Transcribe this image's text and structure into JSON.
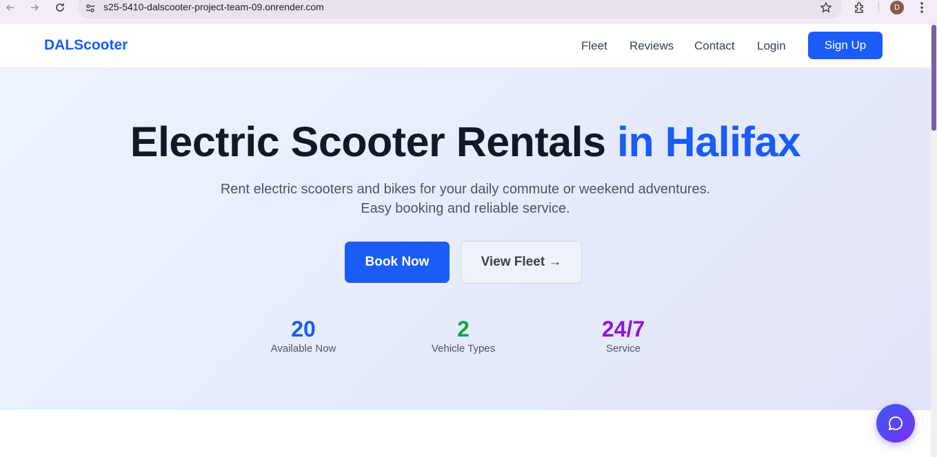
{
  "browser": {
    "url": "s25-5410-dalscooter-project-team-09.onrender.com",
    "profile_initial": "D"
  },
  "header": {
    "brand": "DALScooter",
    "nav": [
      "Fleet",
      "Reviews",
      "Contact",
      "Login"
    ],
    "signup_label": "Sign Up"
  },
  "hero": {
    "title_main": "Electric Scooter Rentals ",
    "title_accent": "in Halifax",
    "subtitle_line1": "Rent electric scooters and bikes for your daily commute or weekend adventures.",
    "subtitle_line2": "Easy booking and reliable service.",
    "primary_cta": "Book Now",
    "secondary_cta": "View Fleet →",
    "stats": [
      {
        "value": "20",
        "label": "Available Now",
        "color": "#1a5cf5"
      },
      {
        "value": "2",
        "label": "Vehicle Types",
        "color": "#16a34a"
      },
      {
        "value": "24/7",
        "label": "Service",
        "color": "#9314e0"
      }
    ]
  },
  "colors": {
    "brand": "#1a5cf5",
    "chat_gradient_start": "#3b5bf5",
    "chat_gradient_end": "#7b2ff0"
  },
  "icons": {
    "chat": "chat-bubble-icon"
  }
}
